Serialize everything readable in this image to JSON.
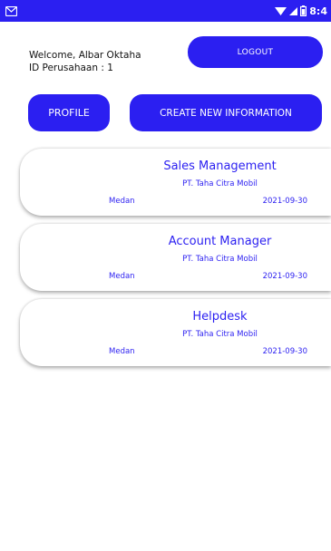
{
  "status_bar": {
    "time": "8:4",
    "bg_color": "#2b1ff1",
    "icons": [
      "gmail-icon",
      "wifi-icon",
      "signal-icon",
      "battery-icon"
    ]
  },
  "header": {
    "welcome_text": "Welcome, Albar Oktaha",
    "company_id_text": "ID Perusahaan : 1",
    "logout_label": "LOGOUT"
  },
  "actions": {
    "profile_label": "PROFILE",
    "create_label": "CREATE NEW INFORMATION"
  },
  "accent_color": "#2b1ff1",
  "jobs": [
    {
      "title": "Sales Management",
      "company": "PT. Taha Citra Mobil",
      "city": "Medan",
      "date": "2021-09-30"
    },
    {
      "title": "Account Manager",
      "company": "PT. Taha Citra Mobil",
      "city": "Medan",
      "date": "2021-09-30"
    },
    {
      "title": "Helpdesk",
      "company": "PT. Taha Citra Mobil",
      "city": "Medan",
      "date": "2021-09-30"
    }
  ]
}
